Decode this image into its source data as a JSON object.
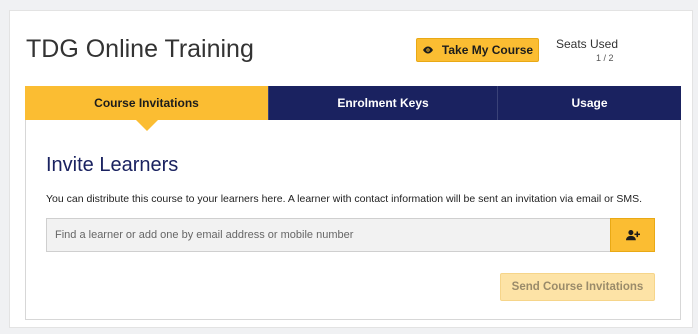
{
  "header": {
    "title": "TDG Online Training",
    "take_course_label": "Take My Course",
    "seats_label": "Seats Used",
    "seats_count": "1 / 2"
  },
  "tabs": [
    {
      "label": "Course Invitations",
      "active": true
    },
    {
      "label": "Enrolment Keys",
      "active": false
    },
    {
      "label": "Usage",
      "active": false
    }
  ],
  "panel": {
    "title": "Invite Learners",
    "description": "You can distribute this course to your learners here. A learner with contact information will be sent an invitation via email or SMS.",
    "search_placeholder": "Find a learner or add one by email address or mobile number",
    "search_value": "",
    "send_label": "Send Course Invitations"
  },
  "icons": {
    "take_course": "eye-icon",
    "add_learner": "add-user-icon"
  },
  "colors": {
    "accent": "#fbbd32",
    "navy": "#1a2260",
    "disabled_button": "#fde3a6"
  }
}
